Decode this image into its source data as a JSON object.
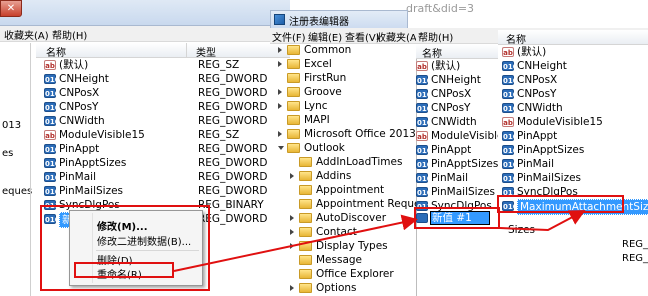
{
  "url_fragment": "draft&did=3",
  "window_title": "注册表编辑器",
  "left_pane": {
    "menu": [
      "收藏夹(A)",
      "帮助(H)"
    ],
    "col_name": "名称",
    "col_type": "类型",
    "rows": [
      {
        "icon": "sz",
        "name": "(默认)",
        "type": "REG_SZ"
      },
      {
        "icon": "dw",
        "name": "CNHeight",
        "type": "REG_DWORD"
      },
      {
        "icon": "dw",
        "name": "CNPosX",
        "type": "REG_DWORD"
      },
      {
        "icon": "dw",
        "name": "CNPosY",
        "type": "REG_DWORD"
      },
      {
        "icon": "dw",
        "name": "CNWidth",
        "type": "REG_DWORD"
      },
      {
        "icon": "sz",
        "name": "ModuleVisible15",
        "type": "REG_SZ"
      },
      {
        "icon": "dw",
        "name": "PinAppt",
        "type": "REG_DWORD"
      },
      {
        "icon": "dw",
        "name": "PinApptSizes",
        "type": "REG_DWORD"
      },
      {
        "icon": "dw",
        "name": "PinMail",
        "type": "REG_DWORD"
      },
      {
        "icon": "dw",
        "name": "PinMailSizes",
        "type": "REG_DWORD"
      },
      {
        "icon": "bn",
        "name": "SyncDlgPos",
        "type": "REG_BINARY"
      },
      {
        "icon": "dw",
        "name": "新值 #1",
        "type": "REG_DWORD"
      }
    ],
    "edge_fragments": [
      "013",
      "es",
      "eques"
    ]
  },
  "context_menu": {
    "modify": "修改(M)...",
    "modify_binary": "修改二进制数据(B)...",
    "delete": "删除(D)",
    "rename": "重命名(R)"
  },
  "middle": {
    "menu": [
      "文件(F)",
      "编辑(E)",
      "查看(V)",
      "收藏夹(A)",
      "帮助(H)"
    ],
    "tree": [
      {
        "label": "Common",
        "indent": 0,
        "exp": "closed"
      },
      {
        "label": "Excel",
        "indent": 0,
        "exp": "closed"
      },
      {
        "label": "FirstRun",
        "indent": 0,
        "exp": "none"
      },
      {
        "label": "Groove",
        "indent": 0,
        "exp": "closed"
      },
      {
        "label": "Lync",
        "indent": 0,
        "exp": "closed"
      },
      {
        "label": "MAPI",
        "indent": 0,
        "exp": "none"
      },
      {
        "label": "Microsoft Office 2013",
        "indent": 0,
        "exp": "closed"
      },
      {
        "label": "Outlook",
        "indent": 0,
        "exp": "open"
      },
      {
        "label": "AddInLoadTimes",
        "indent": 1,
        "exp": "none"
      },
      {
        "label": "Addins",
        "indent": 1,
        "exp": "closed"
      },
      {
        "label": "Appointment",
        "indent": 1,
        "exp": "none"
      },
      {
        "label": "Appointment Reques",
        "indent": 1,
        "exp": "none"
      },
      {
        "label": "AutoDiscover",
        "indent": 1,
        "exp": "closed"
      },
      {
        "label": "Contact",
        "indent": 1,
        "exp": "closed"
      },
      {
        "label": "Display Types",
        "indent": 1,
        "exp": "closed"
      },
      {
        "label": "Message",
        "indent": 1,
        "exp": "none"
      },
      {
        "label": "Office Explorer",
        "indent": 1,
        "exp": "none"
      },
      {
        "label": "Options",
        "indent": 1,
        "exp": "closed"
      }
    ],
    "list_col_name": "名称",
    "list": [
      {
        "icon": "sz",
        "name": "(默认)"
      },
      {
        "icon": "dw",
        "name": "CNHeight"
      },
      {
        "icon": "dw",
        "name": "CNPosX"
      },
      {
        "icon": "dw",
        "name": "CNPosY"
      },
      {
        "icon": "dw",
        "name": "CNWidth"
      },
      {
        "icon": "sz",
        "name": "ModuleVisible1!"
      },
      {
        "icon": "dw",
        "name": "PinAppt"
      },
      {
        "icon": "dw",
        "name": "PinApptSizes"
      },
      {
        "icon": "dw",
        "name": "PinMail"
      },
      {
        "icon": "dw",
        "name": "PinMailSizes"
      },
      {
        "icon": "bn",
        "name": "SyncDlgPos"
      }
    ],
    "edit_label": "新值",
    "edit_value": "新值 #1"
  },
  "right_pane": {
    "col_name": "名称",
    "rows": [
      {
        "icon": "sz",
        "name": "(默认)"
      },
      {
        "icon": "dw",
        "name": "CNHeight"
      },
      {
        "icon": "dw",
        "name": "CNPosX"
      },
      {
        "icon": "dw",
        "name": "CNPosY"
      },
      {
        "icon": "dw",
        "name": "CNWidth"
      },
      {
        "icon": "sz",
        "name": "ModuleVisible15"
      },
      {
        "icon": "dw",
        "name": "PinAppt"
      },
      {
        "icon": "dw",
        "name": "PinApptSizes"
      },
      {
        "icon": "dw",
        "name": "PinMail"
      },
      {
        "icon": "dw",
        "name": "PinMailSizes"
      },
      {
        "icon": "bn",
        "name": "SyncDlgPos"
      },
      {
        "icon": "dw",
        "name": "MaximumAttachmentSize"
      }
    ],
    "fragment_name": "Sizes",
    "type_fragments": [
      "REG_DW",
      "REG_BI"
    ]
  },
  "colors": {
    "highlight": "#3399ff",
    "annotation_red": "#e01010"
  }
}
